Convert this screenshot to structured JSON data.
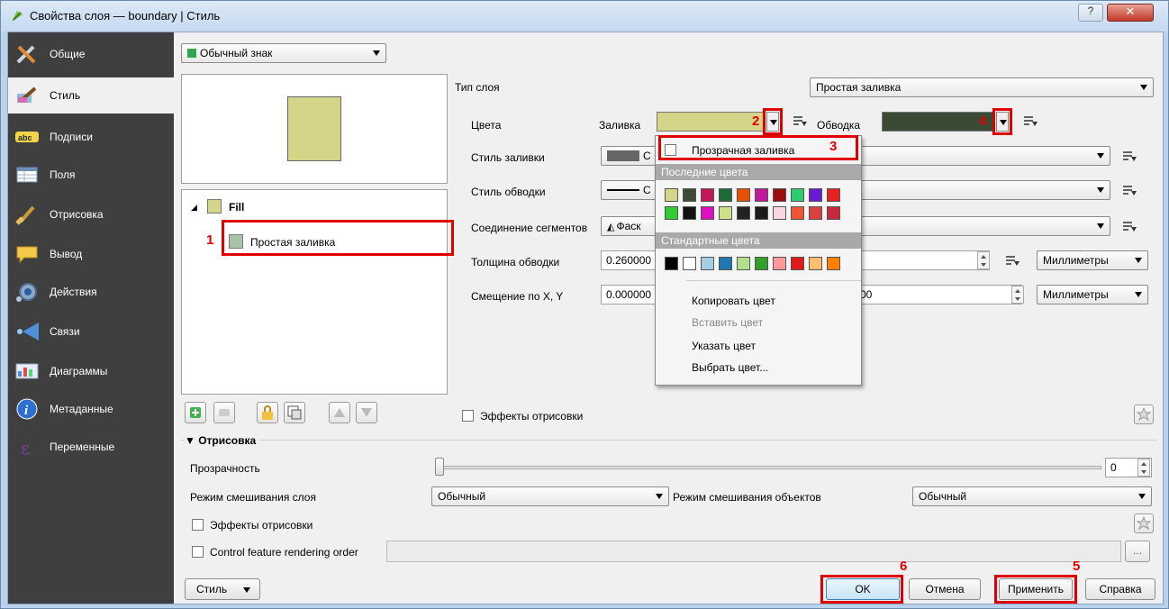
{
  "window": {
    "title": "Свойства слоя — boundary | Стиль"
  },
  "sidebar": {
    "items": [
      {
        "label": "Общие",
        "icon": "tools-icon"
      },
      {
        "label": "Стиль",
        "icon": "brush-style-icon"
      },
      {
        "label": "Подписи",
        "icon": "abc-label-icon"
      },
      {
        "label": "Поля",
        "icon": "table-fields-icon"
      },
      {
        "label": "Отрисовка",
        "icon": "paintbrush-icon"
      },
      {
        "label": "Вывод",
        "icon": "speech-bubble-icon"
      },
      {
        "label": "Действия",
        "icon": "gear-actions-icon"
      },
      {
        "label": "Связи",
        "icon": "relations-icon"
      },
      {
        "label": "Диаграммы",
        "icon": "chart-icon"
      },
      {
        "label": "Метаданные",
        "icon": "info-icon"
      },
      {
        "label": "Переменные",
        "icon": "epsilon-icon"
      }
    ]
  },
  "renderer": {
    "value": "Обычный знак"
  },
  "symbol_tree": {
    "root": "Fill",
    "child": "Простая заливка"
  },
  "layer_props": {
    "type_label": "Тип слоя",
    "type_value": "Простая заливка",
    "colors_label": "Цвета",
    "fill_label": "Заливка",
    "stroke_label": "Обводка",
    "fill_style_label": "Стиль заливки",
    "fill_style_value": "С",
    "stroke_style_label": "Стиль обводки",
    "stroke_style_value": "С",
    "join_label": "Соединение сегментов",
    "join_value": "Фаск",
    "width_label": "Толщина обводки",
    "width_value": "0.260000",
    "width_unit": "Миллиметры",
    "offset_label": "Смещение по X, Y",
    "offset_x": "0.000000",
    "offset_y_tail": "00",
    "offset_unit": "Миллиметры",
    "fill_color": "#d5d58a",
    "stroke_color": "#3a4a35"
  },
  "color_menu": {
    "transparent": "Прозрачная заливка",
    "recent_header": "Последние цвета",
    "standard_header": "Стандартные цвета",
    "recent_colors": [
      "#d5d58a",
      "#3d4a36",
      "#c2185b",
      "#1e6b3a",
      "#e65100",
      "#c2189a",
      "#9b0d0d",
      "#2ecc71",
      "#6a1bd1",
      "#e52222",
      "#33cc33",
      "#111111",
      "#dd10c0",
      "#cfe08a",
      "#222222",
      "#1a1a1a",
      "#f8d9e0",
      "#ee5533",
      "#d94040",
      "#c8283c"
    ],
    "standard_colors": [
      "#000000",
      "#ffffff",
      "#a6cee3",
      "#1f78b4",
      "#b2df8a",
      "#33a02c",
      "#fb9a99",
      "#e31a1c",
      "#fdbf6f",
      "#ff7f00"
    ],
    "copy": "Копировать цвет",
    "paste": "Вставить цвет",
    "pick": "Указать цвет",
    "choose": "Выбрать цвет..."
  },
  "effects_label": "Эффекты отрисовки",
  "rendering": {
    "header": "Отрисовка",
    "transparency_label": "Прозрачность",
    "transparency_value": "0",
    "transparency_level": 0,
    "blend_layer_label": "Режим смешивания слоя",
    "blend_layer_value": "Обычный",
    "blend_feature_label": "Режим смешивания объектов",
    "blend_feature_value": "Обычный",
    "effects_label": "Эффекты отрисовки",
    "order_label": "Control feature rendering order"
  },
  "buttons": {
    "style": "Стиль",
    "ok": "OK",
    "cancel": "Отмена",
    "apply": "Применить",
    "help": "Справка"
  },
  "annotations": [
    "1",
    "2",
    "3",
    "4",
    "5",
    "6"
  ]
}
